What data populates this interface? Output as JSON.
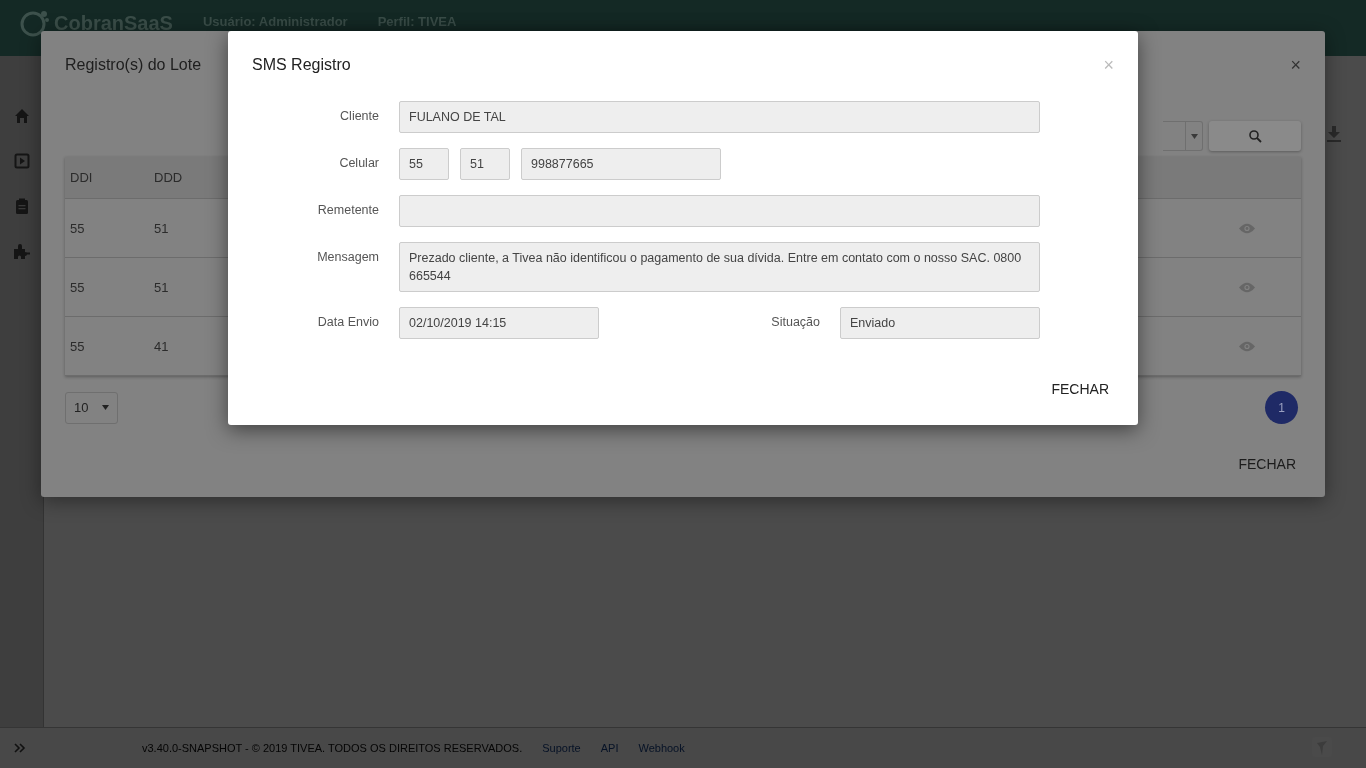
{
  "header": {
    "logo": "CobranSaaS",
    "user": "Usuário: Administrador",
    "profile": "Perfil: TIVEA"
  },
  "batch_dialog": {
    "title": "Registro(s) do Lote",
    "close": "×",
    "table": {
      "columns": [
        "DDI",
        "DDD"
      ],
      "rows": [
        [
          "55",
          "51"
        ],
        [
          "55",
          "51"
        ],
        [
          "55",
          "41"
        ]
      ]
    },
    "page_size": "10",
    "pages": [
      {
        "label": "1",
        "selected": true
      }
    ],
    "button": "FECHAR"
  },
  "sms_dialog": {
    "title": "SMS Registro",
    "close": "×",
    "client": {
      "label": "Cliente",
      "value": "FULANO DE TAL"
    },
    "phone": {
      "label": "Celular",
      "ddi": "55",
      "ddd": "51",
      "number": "998877665"
    },
    "sender": {
      "label": "Remetente"
    },
    "message": {
      "label": "Mensagem",
      "value": "Prezado cliente, a Tivea não identificou o pagamento de sua dívida. Entre em contato com o nosso SAC. 0800 665544"
    },
    "sent_date": {
      "label": "Data Envio",
      "value": "02/10/2019 14:15"
    },
    "status": {
      "label": "Situação",
      "value": "Enviado"
    },
    "button": "FECHAR"
  },
  "footer": {
    "copyright": "v3.40.0-SNAPSHOT - © 2019 TIVEA. TODOS OS DIREITOS RESERVADOS.",
    "links": [
      "Suporte",
      "API",
      "Webhook"
    ]
  }
}
